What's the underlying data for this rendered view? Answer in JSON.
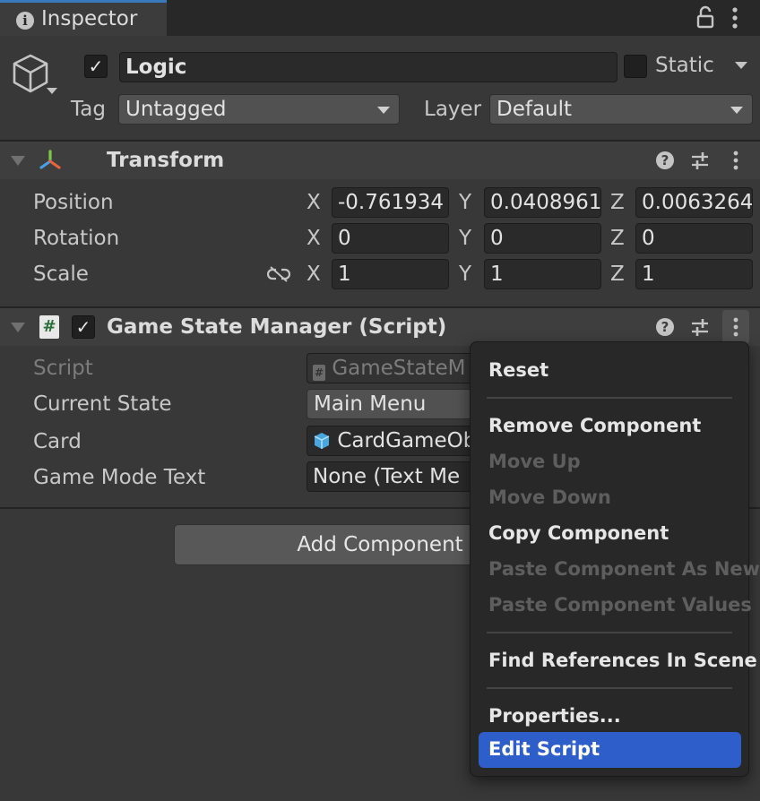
{
  "tab": {
    "title": "Inspector"
  },
  "header": {
    "active": true,
    "name": "Logic",
    "static_label": "Static",
    "tag_label": "Tag",
    "tag_value": "Untagged",
    "layer_label": "Layer",
    "layer_value": "Default"
  },
  "transform": {
    "title": "Transform",
    "position": {
      "label": "Position",
      "x": "-0.761934",
      "y": "0.0408961",
      "z": "0.0063264"
    },
    "rotation": {
      "label": "Rotation",
      "x": "0",
      "y": "0",
      "z": "0"
    },
    "scale": {
      "label": "Scale",
      "x": "1",
      "y": "1",
      "z": "1"
    },
    "axis": {
      "x": "X",
      "y": "Y",
      "z": "Z"
    }
  },
  "script_component": {
    "enabled": true,
    "title": "Game State Manager (Script)",
    "fields": {
      "script_label": "Script",
      "script_value": "GameStateM",
      "state_label": "Current State",
      "state_value": "Main Menu",
      "card_label": "Card",
      "card_value": "CardGameOb",
      "mode_label": "Game Mode Text",
      "mode_value": "None (Text Me"
    }
  },
  "add_component_label": "Add Component",
  "context_menu": {
    "reset": "Reset",
    "remove": "Remove Component",
    "move_up": "Move Up",
    "move_down": "Move Down",
    "copy": "Copy Component",
    "paste_new": "Paste Component As New",
    "paste_values": "Paste Component Values",
    "find_refs": "Find References In Scene",
    "properties": "Properties...",
    "edit_script": "Edit Script"
  },
  "colors": {
    "accent": "#3a79bb",
    "selection": "#2d5ec9"
  }
}
